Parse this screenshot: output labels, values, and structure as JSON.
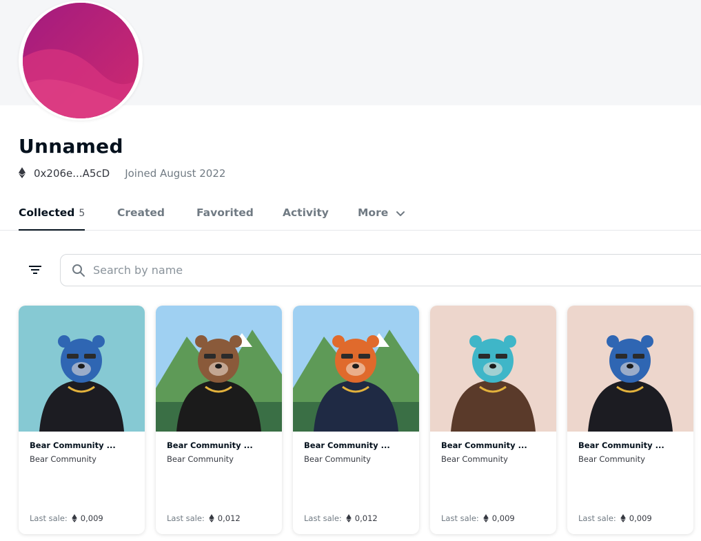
{
  "profile": {
    "name": "Unnamed",
    "address": "0x206e...A5cD",
    "joined": "Joined August 2022",
    "avatar_icon": "avatar-gradient-image"
  },
  "tabs": [
    {
      "label": "Collected",
      "count": "5",
      "active": true
    },
    {
      "label": "Created"
    },
    {
      "label": "Favorited"
    },
    {
      "label": "Activity"
    },
    {
      "label": "More"
    }
  ],
  "search": {
    "placeholder": "Search by name",
    "value": ""
  },
  "icons": {
    "filter": "filter-icon",
    "search": "search-icon",
    "eth": "ethereum-icon",
    "chevron": "chevron-down-icon"
  },
  "cards": [
    {
      "title": "Bear Community ...",
      "collection": "Bear Community",
      "sale_label": "Last sale:",
      "price": "0,009",
      "bg": "#86c9d3",
      "bear": "#2f66b3",
      "shirt": "#1c1c22"
    },
    {
      "title": "Bear Community ...",
      "collection": "Bear Community",
      "sale_label": "Last sale:",
      "price": "0,012",
      "bg": "#9fd0f2",
      "bear": "#8a5a3a",
      "shirt": "#1b1b1b"
    },
    {
      "title": "Bear Community ...",
      "collection": "Bear Community",
      "sale_label": "Last sale:",
      "price": "0,012",
      "bg": "#9fd0f2",
      "bear": "#e06a2c",
      "shirt": "#1f2a44"
    },
    {
      "title": "Bear Community ...",
      "collection": "Bear Community",
      "sale_label": "Last sale:",
      "price": "0,009",
      "bg": "#edd6cc",
      "bear": "#3fb6c8",
      "shirt": "#5a3a2a"
    },
    {
      "title": "Bear Community ...",
      "collection": "Bear Community",
      "sale_label": "Last sale:",
      "price": "0,009",
      "bg": "#edd6cc",
      "bear": "#2f66b3",
      "shirt": "#1c1c22"
    }
  ]
}
